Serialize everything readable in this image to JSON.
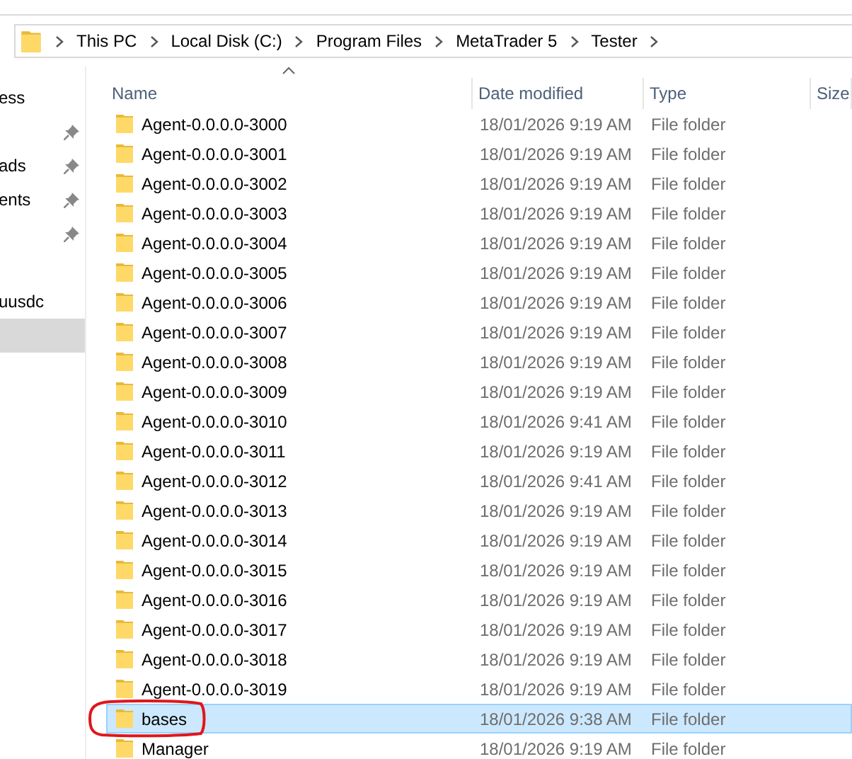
{
  "address_bar": {
    "path": [
      "This PC",
      "Local Disk (C:)",
      "Program Files",
      "MetaTrader 5",
      "Tester"
    ]
  },
  "nav_pane": {
    "items": [
      {
        "label": "ess",
        "pinned": false,
        "selected": false
      },
      {
        "pinned": true,
        "selected": false
      },
      {
        "label": "ads",
        "pinned": true,
        "selected": false
      },
      {
        "label": "ents",
        "pinned": true,
        "selected": false
      },
      {
        "pinned": true,
        "selected": false
      },
      {
        "pinned": false,
        "selected": false
      },
      {
        "label": "uusdc",
        "pinned": false,
        "selected": false
      },
      {
        "pinned": false,
        "selected": true
      }
    ]
  },
  "columns": [
    {
      "label": "Name",
      "sorted": true
    },
    {
      "label": "Date modified",
      "sorted": false
    },
    {
      "label": "Type",
      "sorted": false
    },
    {
      "label": "Size",
      "sorted": false
    }
  ],
  "rows": [
    {
      "name": "Agent-0.0.0.0-3000",
      "date": "18/01/2026 9:19 AM",
      "type": "File folder",
      "selected": false,
      "circled": false
    },
    {
      "name": "Agent-0.0.0.0-3001",
      "date": "18/01/2026 9:19 AM",
      "type": "File folder",
      "selected": false,
      "circled": false
    },
    {
      "name": "Agent-0.0.0.0-3002",
      "date": "18/01/2026 9:19 AM",
      "type": "File folder",
      "selected": false,
      "circled": false
    },
    {
      "name": "Agent-0.0.0.0-3003",
      "date": "18/01/2026 9:19 AM",
      "type": "File folder",
      "selected": false,
      "circled": false
    },
    {
      "name": "Agent-0.0.0.0-3004",
      "date": "18/01/2026 9:19 AM",
      "type": "File folder",
      "selected": false,
      "circled": false
    },
    {
      "name": "Agent-0.0.0.0-3005",
      "date": "18/01/2026 9:19 AM",
      "type": "File folder",
      "selected": false,
      "circled": false
    },
    {
      "name": "Agent-0.0.0.0-3006",
      "date": "18/01/2026 9:19 AM",
      "type": "File folder",
      "selected": false,
      "circled": false
    },
    {
      "name": "Agent-0.0.0.0-3007",
      "date": "18/01/2026 9:19 AM",
      "type": "File folder",
      "selected": false,
      "circled": false
    },
    {
      "name": "Agent-0.0.0.0-3008",
      "date": "18/01/2026 9:19 AM",
      "type": "File folder",
      "selected": false,
      "circled": false
    },
    {
      "name": "Agent-0.0.0.0-3009",
      "date": "18/01/2026 9:19 AM",
      "type": "File folder",
      "selected": false,
      "circled": false
    },
    {
      "name": "Agent-0.0.0.0-3010",
      "date": "18/01/2026 9:41 AM",
      "type": "File folder",
      "selected": false,
      "circled": false
    },
    {
      "name": "Agent-0.0.0.0-3011",
      "date": "18/01/2026 9:19 AM",
      "type": "File folder",
      "selected": false,
      "circled": false
    },
    {
      "name": "Agent-0.0.0.0-3012",
      "date": "18/01/2026 9:41 AM",
      "type": "File folder",
      "selected": false,
      "circled": false
    },
    {
      "name": "Agent-0.0.0.0-3013",
      "date": "18/01/2026 9:19 AM",
      "type": "File folder",
      "selected": false,
      "circled": false
    },
    {
      "name": "Agent-0.0.0.0-3014",
      "date": "18/01/2026 9:19 AM",
      "type": "File folder",
      "selected": false,
      "circled": false
    },
    {
      "name": "Agent-0.0.0.0-3015",
      "date": "18/01/2026 9:19 AM",
      "type": "File folder",
      "selected": false,
      "circled": false
    },
    {
      "name": "Agent-0.0.0.0-3016",
      "date": "18/01/2026 9:19 AM",
      "type": "File folder",
      "selected": false,
      "circled": false
    },
    {
      "name": "Agent-0.0.0.0-3017",
      "date": "18/01/2026 9:19 AM",
      "type": "File folder",
      "selected": false,
      "circled": false
    },
    {
      "name": "Agent-0.0.0.0-3018",
      "date": "18/01/2026 9:19 AM",
      "type": "File folder",
      "selected": false,
      "circled": false
    },
    {
      "name": "Agent-0.0.0.0-3019",
      "date": "18/01/2026 9:19 AM",
      "type": "File folder",
      "selected": false,
      "circled": false
    },
    {
      "name": "bases",
      "date": "18/01/2026 9:38 AM",
      "type": "File folder",
      "selected": true,
      "circled": true
    },
    {
      "name": "Manager",
      "date": "18/01/2026 9:19 AM",
      "type": "File folder",
      "selected": false,
      "circled": false
    }
  ]
}
